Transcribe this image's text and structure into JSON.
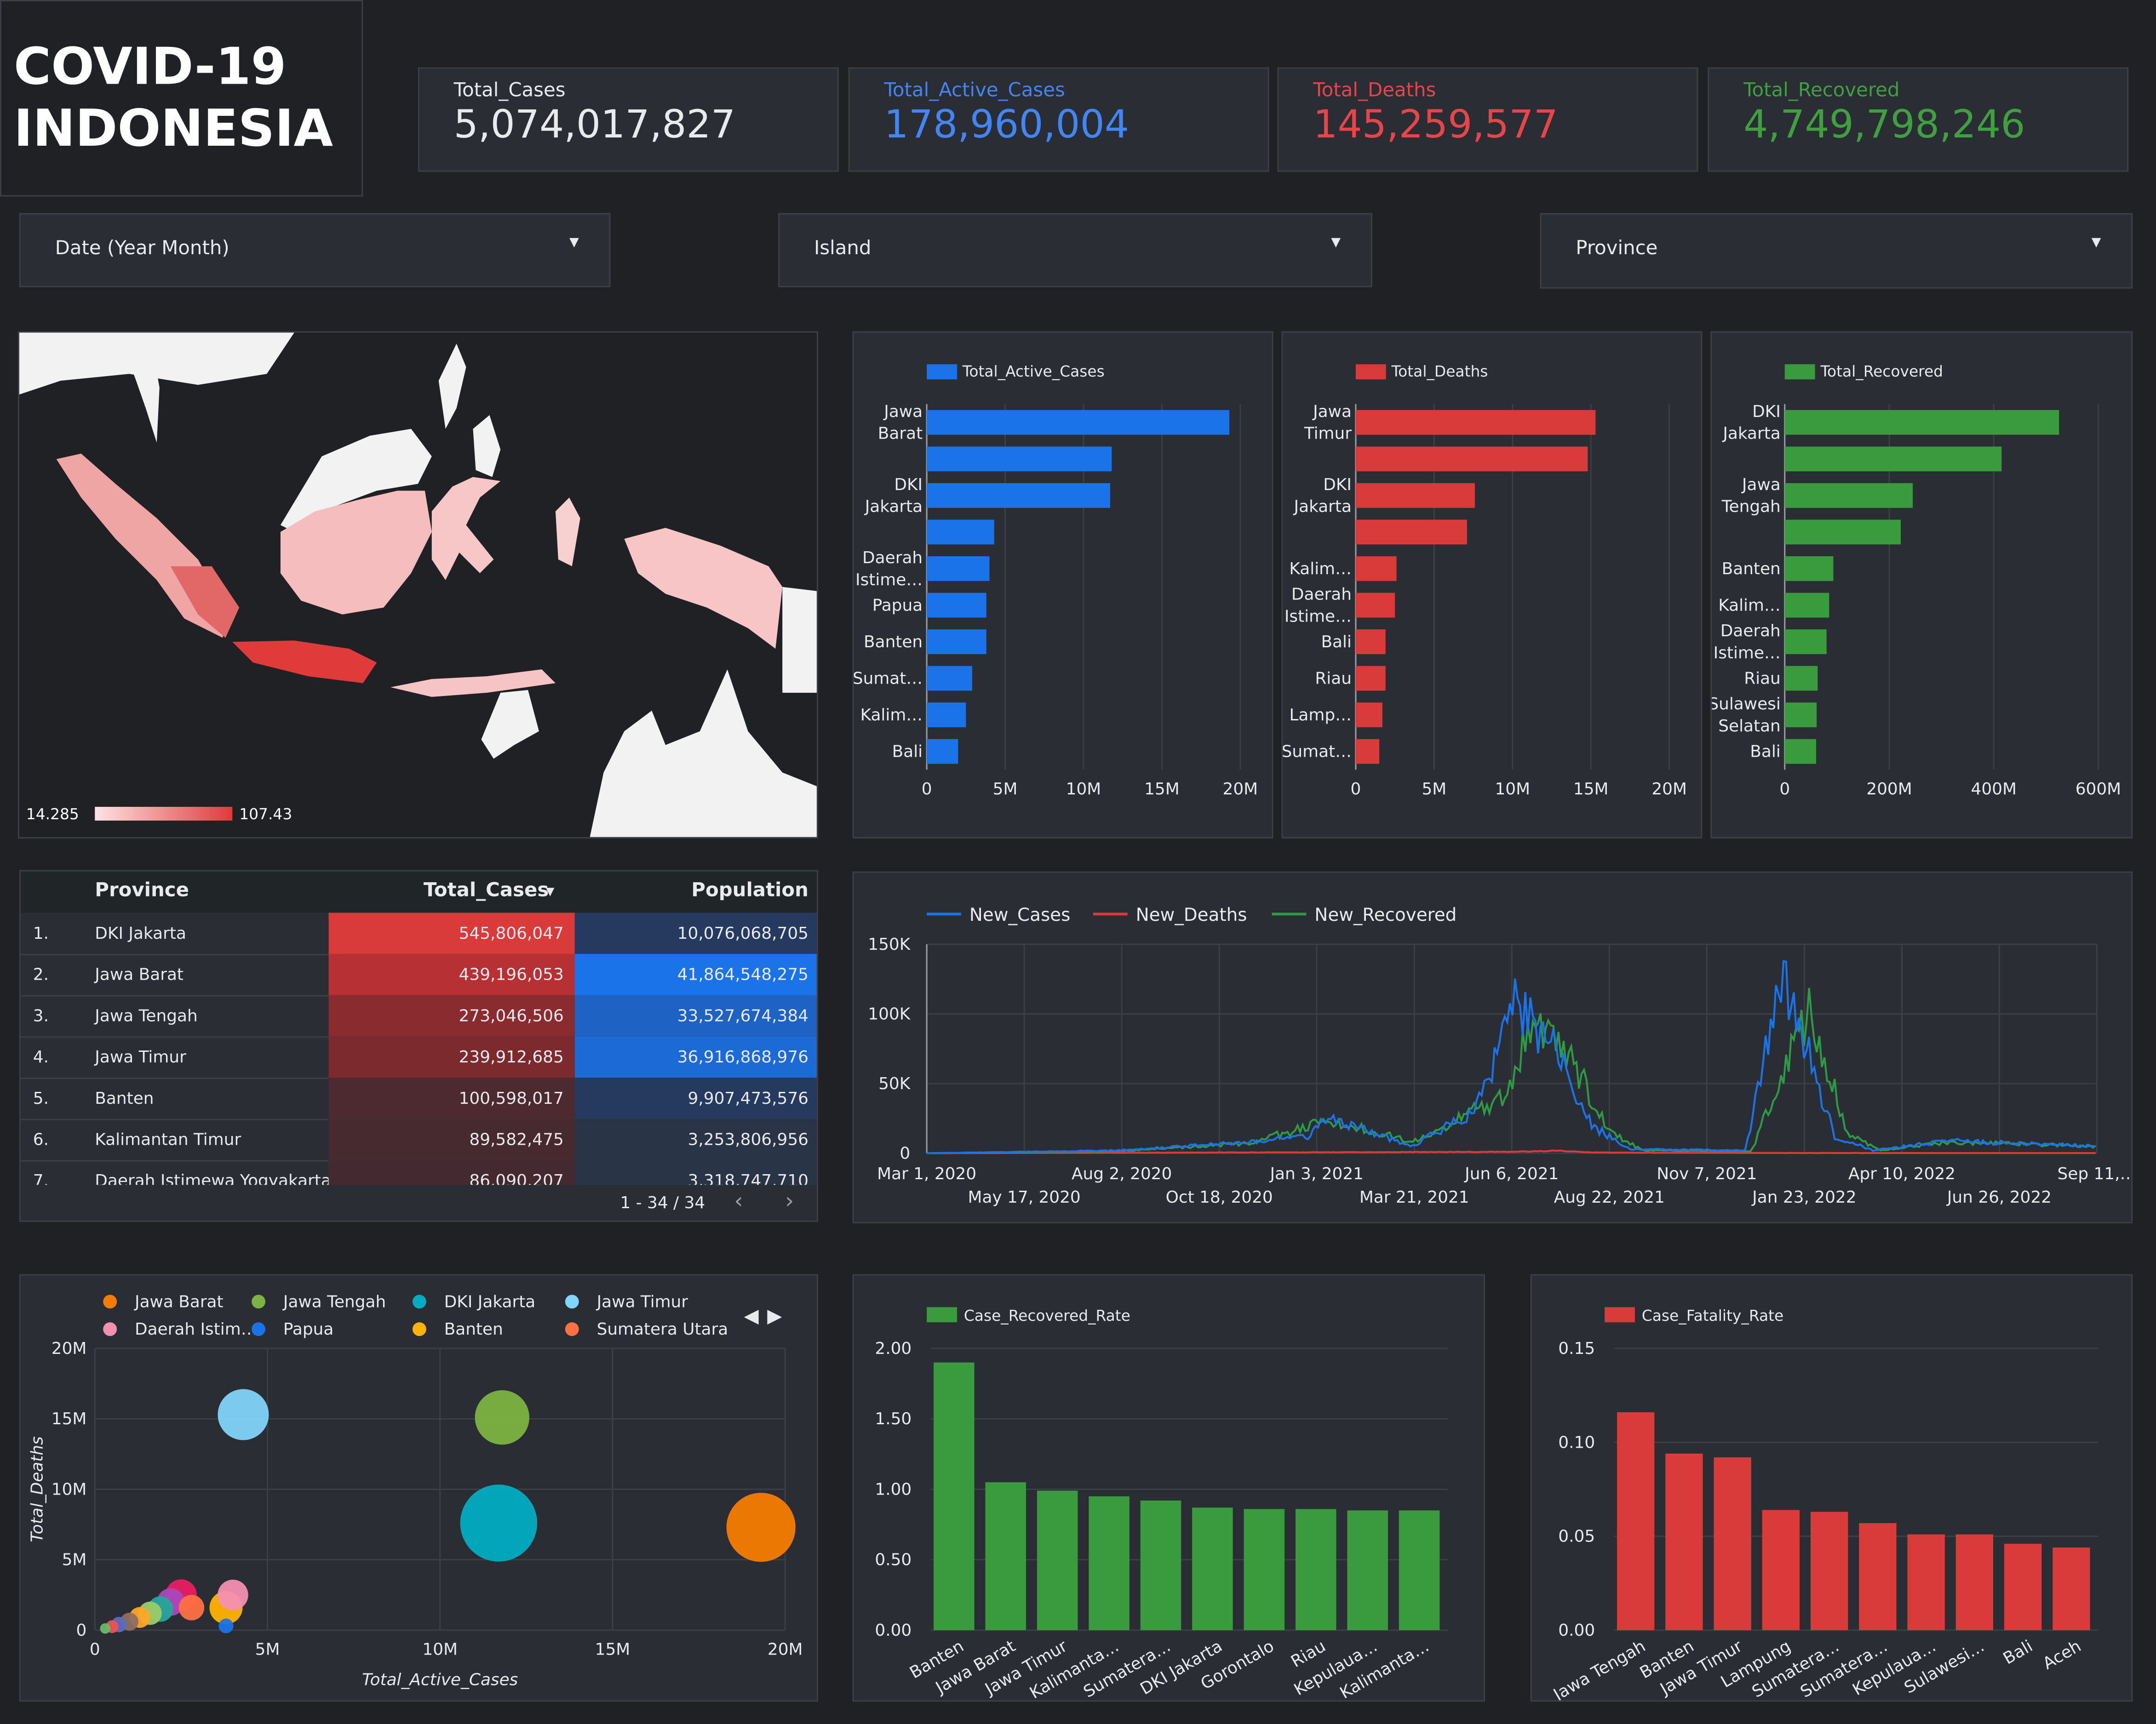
{
  "header": {
    "title_line1": "COVID-19",
    "title_line2": "INDONESIA"
  },
  "kpis": [
    {
      "label": "Total_Cases",
      "value": "5,074,017,827",
      "color": "#e8eaed"
    },
    {
      "label": "Total_Active_Cases",
      "value": "178,960,004",
      "color": "#4285f4"
    },
    {
      "label": "Total_Deaths",
      "value": "145,259,577",
      "color": "#e8454b"
    },
    {
      "label": "Total_Recovered",
      "value": "4,749,798,246",
      "color": "#3ea03f"
    }
  ],
  "filters": [
    {
      "label": "Date (Year Month)"
    },
    {
      "label": "Island"
    },
    {
      "label": "Province"
    }
  ],
  "map": {
    "legend_min": "14.285",
    "legend_max": "107.43"
  },
  "table": {
    "headers": {
      "province": "Province",
      "cases": "Total_Cases",
      "population": "Population"
    },
    "rows": [
      {
        "rank": "1.",
        "province": "DKI Jakarta",
        "cases": "545,806,047",
        "population": "10,076,068,705"
      },
      {
        "rank": "2.",
        "province": "Jawa Barat",
        "cases": "439,196,053",
        "population": "41,864,548,275"
      },
      {
        "rank": "3.",
        "province": "Jawa Tengah",
        "cases": "273,046,506",
        "population": "33,527,674,384"
      },
      {
        "rank": "4.",
        "province": "Jawa Timur",
        "cases": "239,912,685",
        "population": "36,916,868,976"
      },
      {
        "rank": "5.",
        "province": "Banten",
        "cases": "100,598,017",
        "population": "9,907,473,576"
      },
      {
        "rank": "6.",
        "province": "Kalimantan Timur",
        "cases": "89,582,475",
        "population": "3,253,806,956"
      },
      {
        "rank": "7.",
        "province": "Daerah Istimewa Yogyakarta",
        "cases": "86,090,207",
        "population": "3,318,747,710"
      }
    ],
    "pager": "1 - 34 / 34"
  },
  "chart_data": [
    {
      "type": "bar",
      "orientation": "horizontal",
      "series": [
        {
          "name": "Total_Active_Cases",
          "color": "#1a73e8",
          "values": [
            19300000,
            11800000,
            11700000,
            4300000,
            4000000,
            3800000,
            3800000,
            2900000,
            2500000,
            2000000
          ]
        }
      ],
      "categories": [
        "Jawa Barat",
        "",
        "DKI Jakarta",
        "",
        "Daerah Istime…",
        "Papua",
        "Banten",
        "Sumat…",
        "Kalim…",
        "Bali"
      ],
      "category_lines": [
        [
          "Jawa",
          "Barat"
        ],
        [],
        [
          "DKI",
          "Jakarta"
        ],
        [],
        [
          "Daerah",
          "Istime…"
        ],
        [
          "Papua"
        ],
        [
          "Banten"
        ],
        [
          "Sumat…"
        ],
        [
          "Kalim…"
        ],
        [
          "Bali"
        ]
      ],
      "xlim": [
        0,
        20000000
      ],
      "xticks": [
        "0",
        "5M",
        "10M",
        "15M",
        "20M"
      ],
      "grid": true,
      "legend": "top-left"
    },
    {
      "type": "bar",
      "orientation": "horizontal",
      "series": [
        {
          "name": "Total_Deaths",
          "color": "#d93b3b",
          "values": [
            15300000,
            14800000,
            7600000,
            7100000,
            2600000,
            2500000,
            1900000,
            1900000,
            1700000,
            1500000
          ]
        }
      ],
      "categories": [
        "Jawa Timur",
        "",
        "DKI Jakarta",
        "",
        "Kalim…",
        "Daerah Istime…",
        "Bali",
        "Riau",
        "Lamp…",
        "Sumat…"
      ],
      "category_lines": [
        [
          "Jawa",
          "Timur"
        ],
        [],
        [
          "DKI",
          "Jakarta"
        ],
        [],
        [
          "Kalim…"
        ],
        [
          "Daerah",
          "Istime…"
        ],
        [
          "Bali"
        ],
        [
          "Riau"
        ],
        [
          "Lamp…"
        ],
        [
          "Sumat…"
        ]
      ],
      "xlim": [
        0,
        20000000
      ],
      "xticks": [
        "0",
        "5M",
        "10M",
        "15M",
        "20M"
      ],
      "grid": true,
      "legend": "top-left"
    },
    {
      "type": "bar",
      "orientation": "horizontal",
      "series": [
        {
          "name": "Total_Recovered",
          "color": "#3a9a3e",
          "values": [
            525000000,
            415000000,
            245000000,
            222000000,
            93000000,
            85000000,
            80000000,
            63000000,
            61000000,
            60000000
          ]
        }
      ],
      "categories": [
        "DKI Jakarta",
        "",
        "Jawa Tengah",
        "",
        "Banten",
        "Kalim…",
        "Daerah Istime…",
        "Riau",
        "Sulawesi Selatan",
        "Bali"
      ],
      "category_lines": [
        [
          "DKI",
          "Jakarta"
        ],
        [],
        [
          "Jawa",
          "Tengah"
        ],
        [],
        [
          "Banten"
        ],
        [
          "Kalim…"
        ],
        [
          "Daerah",
          "Istime…"
        ],
        [
          "Riau"
        ],
        [
          "Sulawesi",
          "Selatan"
        ],
        [
          "Bali"
        ]
      ],
      "xlim": [
        0,
        600000000
      ],
      "xticks": [
        "0",
        "200M",
        "400M",
        "600M"
      ],
      "grid": true,
      "legend": "top-left"
    },
    {
      "type": "line",
      "series": [
        {
          "name": "New_Cases",
          "color": "#1a73e8"
        },
        {
          "name": "New_Deaths",
          "color": "#d93b3b"
        },
        {
          "name": "New_Recovered",
          "color": "#2e9a45"
        }
      ],
      "x_start": "Mar 1, 2020",
      "x_end": "Sep 11, 2022",
      "shape_points": {
        "New_Cases": [
          [
            0,
            0
          ],
          [
            150,
            2000
          ],
          [
            250,
            8000
          ],
          [
            300,
            12000
          ],
          [
            310,
            26000
          ],
          [
            330,
            20000
          ],
          [
            380,
            5000
          ],
          [
            430,
            32000
          ],
          [
            460,
            110000
          ],
          [
            490,
            75000
          ],
          [
            520,
            20000
          ],
          [
            550,
            3000
          ],
          [
            640,
            2000
          ],
          [
            660,
            90000
          ],
          [
            670,
            128000
          ],
          [
            690,
            70000
          ],
          [
            710,
            12000
          ],
          [
            740,
            2000
          ],
          [
            800,
            9000
          ],
          [
            915,
            5000
          ]
        ],
        "New_Deaths": [
          [
            0,
            0
          ],
          [
            460,
            1000
          ],
          [
            490,
            1800
          ],
          [
            520,
            500
          ],
          [
            670,
            150
          ],
          [
            915,
            100
          ]
        ],
        "New_Recovered": [
          [
            0,
            0
          ],
          [
            150,
            1500
          ],
          [
            250,
            7000
          ],
          [
            310,
            22000
          ],
          [
            340,
            18000
          ],
          [
            380,
            8000
          ],
          [
            450,
            40000
          ],
          [
            475,
            95000
          ],
          [
            505,
            65000
          ],
          [
            535,
            15000
          ],
          [
            560,
            2000
          ],
          [
            645,
            1500
          ],
          [
            670,
            60000
          ],
          [
            690,
            100000
          ],
          [
            705,
            60000
          ],
          [
            720,
            15000
          ],
          [
            745,
            2000
          ],
          [
            800,
            8000
          ],
          [
            915,
            5000
          ]
        ]
      },
      "x_tick_labels_row1": [
        "Mar 1, 2020",
        "Aug 2, 2020",
        "Jan 3, 2021",
        "Jun 6, 2021",
        "Nov 7, 2021",
        "Apr 10, 2022",
        "Sep 11,…"
      ],
      "x_tick_labels_row2": [
        "May 17, 2020",
        "Oct 18, 2020",
        "Mar 21, 2021",
        "Aug 22, 2021",
        "Jan 23, 2022",
        "Jun 26, 2022"
      ],
      "ylim": [
        0,
        150000
      ],
      "yticks": [
        "0",
        "50K",
        "100K",
        "150K"
      ],
      "grid": true,
      "legend": "top-left"
    },
    {
      "type": "scatter",
      "bubble": true,
      "legend_entries": [
        {
          "name": "Jawa Barat",
          "color": "#f57c00"
        },
        {
          "name": "Jawa Tengah",
          "color": "#7cb342"
        },
        {
          "name": "DKI Jakarta",
          "color": "#00acc1"
        },
        {
          "name": "Jawa Timur",
          "color": "#81d4fa"
        },
        {
          "name": "Daerah Istim…",
          "color": "#f48fb1"
        },
        {
          "name": "Papua",
          "color": "#1a73e8"
        },
        {
          "name": "Banten",
          "color": "#ffb300"
        },
        {
          "name": "Sumatera Utara",
          "color": "#ff7043"
        }
      ],
      "points": [
        {
          "name": "Jawa Barat",
          "x": 19300000,
          "y": 7300000,
          "size": 439196053,
          "color": "#f57c00"
        },
        {
          "name": "Jawa Tengah",
          "x": 11800000,
          "y": 15100000,
          "size": 273046506,
          "color": "#7cb342"
        },
        {
          "name": "DKI Jakarta",
          "x": 11700000,
          "y": 7600000,
          "size": 545806047,
          "color": "#00acc1"
        },
        {
          "name": "Jawa Timur",
          "x": 4300000,
          "y": 15300000,
          "size": 239912685,
          "color": "#81d4fa"
        },
        {
          "name": "Daerah Istim…",
          "x": 4000000,
          "y": 2500000,
          "size": 86090207,
          "color": "#f48fb1"
        },
        {
          "name": "Papua",
          "x": 3800000,
          "y": 300000,
          "size": 20000000,
          "color": "#1a73e8"
        },
        {
          "name": "Banten",
          "x": 3800000,
          "y": 1600000,
          "size": 100598017,
          "color": "#ffb300"
        },
        {
          "name": "Sumatera Utara",
          "x": 2800000,
          "y": 1600000,
          "size": 60000000,
          "color": "#ff7043"
        },
        {
          "name": "",
          "x": 2500000,
          "y": 2500000,
          "size": 89582475,
          "color": "#e91e63"
        },
        {
          "name": "",
          "x": 2200000,
          "y": 2000000,
          "size": 70000000,
          "color": "#ab47bc"
        },
        {
          "name": "",
          "x": 1900000,
          "y": 1500000,
          "size": 60000000,
          "color": "#26a69a"
        },
        {
          "name": "",
          "x": 1600000,
          "y": 1200000,
          "size": 50000000,
          "color": "#9ccc65"
        },
        {
          "name": "",
          "x": 1300000,
          "y": 900000,
          "size": 40000000,
          "color": "#ffa726"
        },
        {
          "name": "",
          "x": 1000000,
          "y": 600000,
          "size": 30000000,
          "color": "#8d6e63"
        },
        {
          "name": "",
          "x": 700000,
          "y": 400000,
          "size": 22000000,
          "color": "#5c6bc0"
        },
        {
          "name": "",
          "x": 500000,
          "y": 250000,
          "size": 15000000,
          "color": "#ef5350"
        },
        {
          "name": "",
          "x": 300000,
          "y": 120000,
          "size": 10000000,
          "color": "#66bb6a"
        }
      ],
      "xlabel": "Total_Active_Cases",
      "ylabel": "Total_Deaths",
      "xlim": [
        0,
        20000000
      ],
      "ylim": [
        0,
        20000000
      ],
      "xticks": [
        "0",
        "5M",
        "10M",
        "15M",
        "20M"
      ],
      "yticks": [
        "0",
        "5M",
        "10M",
        "15M",
        "20M"
      ],
      "grid": true
    },
    {
      "type": "bar",
      "series": [
        {
          "name": "Case_Recovered_Rate",
          "color": "#3a9a3e",
          "values": [
            1.9,
            1.05,
            0.99,
            0.95,
            0.92,
            0.87,
            0.86,
            0.86,
            0.85,
            0.85
          ]
        }
      ],
      "categories": [
        "Banten",
        "Jawa Barat",
        "Jawa Timur",
        "Kalimanta…",
        "Sumatera…",
        "DKI Jakarta",
        "Gorontalo",
        "Riau",
        "Kepulaua…",
        "Kalimanta…"
      ],
      "ylim": [
        0,
        2.0
      ],
      "yticks": [
        "0.00",
        "0.50",
        "1.00",
        "1.50",
        "2.00"
      ],
      "grid": true,
      "legend": "top-left"
    },
    {
      "type": "bar",
      "series": [
        {
          "name": "Case_Fatality_Rate",
          "color": "#d93b3b",
          "values": [
            0.116,
            0.094,
            0.092,
            0.064,
            0.063,
            0.057,
            0.051,
            0.051,
            0.046,
            0.044
          ]
        }
      ],
      "categories": [
        "Jawa Tengah",
        "Banten",
        "Jawa Timur",
        "Lampung",
        "Sumatera…",
        "Sumatera…",
        "Kepulaua…",
        "Sulawesi…",
        "Bali",
        "Aceh"
      ],
      "ylim": [
        0,
        0.15
      ],
      "yticks": [
        "0.00",
        "0.05",
        "0.10",
        "0.15"
      ],
      "grid": true,
      "legend": "top-left"
    }
  ]
}
